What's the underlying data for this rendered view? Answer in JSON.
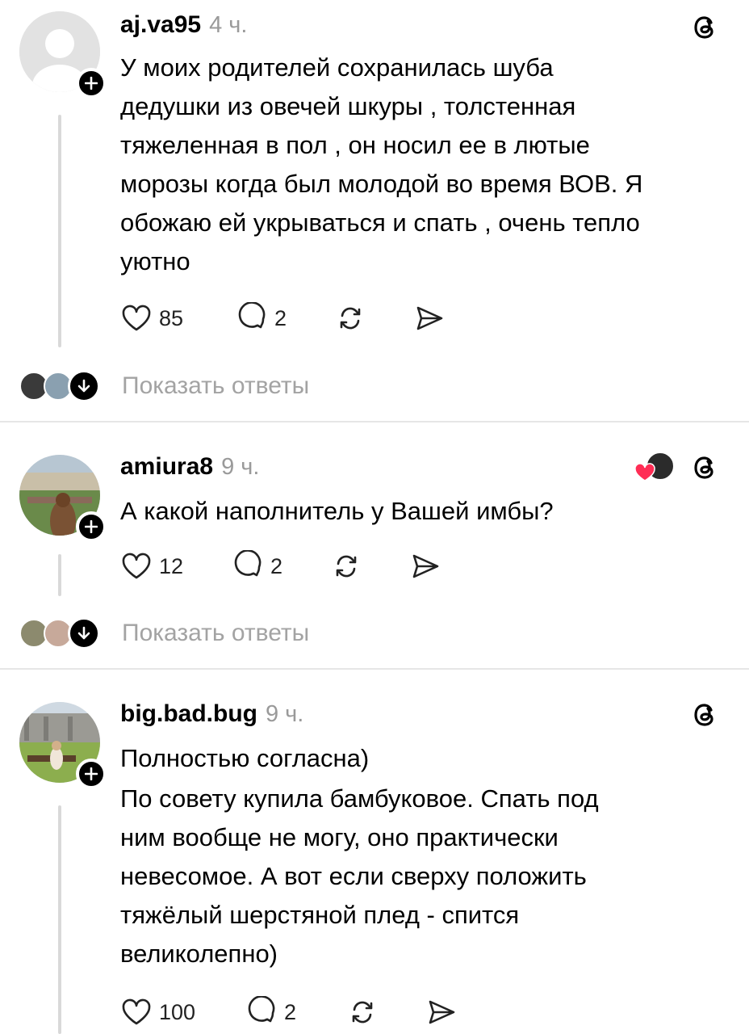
{
  "posts": [
    {
      "username": "aj.va95",
      "time": "4 ч.",
      "lines": [
        "У моих родителей сохранилась шуба",
        "дедушки из овечей шкуры , толстенная",
        "тяжеленная в пол , он носил ее в лютые",
        "морозы когда был молодой во время ВОВ. Я",
        "обожаю ей укрываться и спать , очень тепло",
        "уютно"
      ],
      "likes": "85",
      "comments": "2",
      "show_replies": "Показать ответы"
    },
    {
      "username": "amiura8",
      "time": "9 ч.",
      "lines": [
        "А какой наполнитель у Вашей имбы?"
      ],
      "likes": "12",
      "comments": "2",
      "show_replies": "Показать ответы"
    },
    {
      "username": "big.bad.bug",
      "time": "9 ч.",
      "lines": [
        "Полностью согласна)",
        "По совету купила бамбуковое. Спать под",
        "ним вообще не могу, оно практически",
        "невесомое. А вот если сверху положить",
        "тяжёлый шерстяной плед - спится",
        "великолепно)"
      ],
      "likes": "100",
      "comments": "2"
    }
  ],
  "icons": {
    "threads": "threads-logo-icon",
    "like": "heart-icon",
    "comment": "comment-bubble-icon",
    "repost": "repost-icon",
    "share": "send-icon",
    "follow": "plus-icon",
    "expand": "arrow-down-icon",
    "liked_by_author": "heart-filled-icon"
  },
  "colors": {
    "accent_heart": "#ff2d55",
    "muted_text": "#9a9a9a"
  }
}
